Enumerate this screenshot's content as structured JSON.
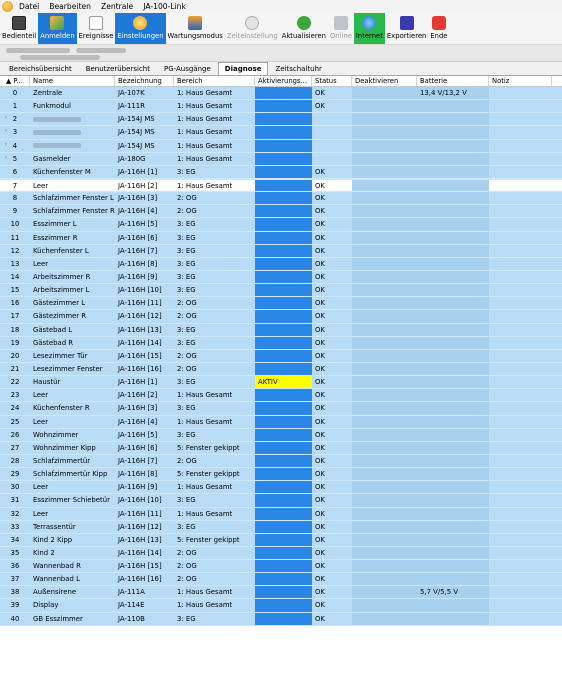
{
  "menu": {
    "items": [
      "Datei",
      "Bearbeiten",
      "Zentrale",
      "JA-100-Link"
    ]
  },
  "toolbar": {
    "buttons": [
      {
        "label": "Bedienteil",
        "icon": "keypad-icon"
      },
      {
        "label": "Anmelden",
        "icon": "login-icon"
      },
      {
        "label": "Ereignisse",
        "icon": "events-icon"
      },
      {
        "label": "Einstellungen",
        "icon": "settings-icon"
      },
      {
        "label": "Wartungsmodus",
        "icon": "maintenance-icon"
      },
      {
        "label": "Zeiteinstellung",
        "icon": "clock-icon"
      },
      {
        "label": "Aktualisieren",
        "icon": "refresh-icon"
      },
      {
        "label": "Online",
        "icon": "online-icon"
      },
      {
        "label": "Internet",
        "icon": "internet-icon"
      },
      {
        "label": "Exportieren",
        "icon": "export-icon"
      },
      {
        "label": "Ende",
        "icon": "power-icon"
      }
    ]
  },
  "tabs": [
    "Bereichsübersicht",
    "Benutzerübersicht",
    "PG-Ausgänge",
    "Diagnose",
    "Zeitschaltuhr"
  ],
  "active_tab": "Diagnose",
  "table": {
    "headers": [
      "P...",
      "Name",
      "Bezeichnung",
      "Bereich",
      "Aktivierungs...",
      "Status",
      "Deaktivieren",
      "Batterie",
      "Notiz"
    ],
    "rows": [
      {
        "p": "0",
        "name": "Zentrale",
        "bez": "JA-107K",
        "ber": "1: Haus Gesamt",
        "akt": "",
        "status": "OK",
        "batt": "13,4 V/13,2 V"
      },
      {
        "p": "1",
        "name": "Funkmodul",
        "bez": "JA-111R",
        "ber": "1: Haus Gesamt",
        "akt": "",
        "status": "OK",
        "batt": ""
      },
      {
        "p": "2",
        "name": "",
        "bez": "JA-154J MS",
        "ber": "1: Haus Gesamt",
        "akt": "",
        "status": "",
        "batt": ""
      },
      {
        "p": "3",
        "name": "",
        "bez": "JA-154J MS",
        "ber": "1: Haus Gesamt",
        "akt": "",
        "status": "",
        "batt": ""
      },
      {
        "p": "4",
        "name": "",
        "bez": "JA-154J MS",
        "ber": "1: Haus Gesamt",
        "akt": "",
        "status": "",
        "batt": ""
      },
      {
        "p": "5",
        "name": "Gasmelder",
        "bez": "JA-180G",
        "ber": "1: Haus Gesamt",
        "akt": "",
        "status": "",
        "batt": ""
      },
      {
        "p": "6",
        "name": "Küchenfenster M",
        "bez": "JA-116H [1]",
        "ber": "3: EG",
        "akt": "",
        "status": "OK",
        "batt": ""
      },
      {
        "p": "7",
        "name": "Leer",
        "bez": "JA-116H [2]",
        "ber": "1: Haus Gesamt",
        "akt": "",
        "status": "OK",
        "batt": ""
      },
      {
        "p": "8",
        "name": "Schlafzimmer Fenster L",
        "bez": "JA-116H [3]",
        "ber": "2: OG",
        "akt": "",
        "status": "OK",
        "batt": ""
      },
      {
        "p": "9",
        "name": "Schlafzimmer Fenster R",
        "bez": "JA-116H [4]",
        "ber": "2: OG",
        "akt": "",
        "status": "OK",
        "batt": ""
      },
      {
        "p": "10",
        "name": "Esszimmer L",
        "bez": "JA-116H [5]",
        "ber": "3: EG",
        "akt": "",
        "status": "OK",
        "batt": ""
      },
      {
        "p": "11",
        "name": "Esszimmer R",
        "bez": "JA-116H [6]",
        "ber": "3: EG",
        "akt": "",
        "status": "OK",
        "batt": ""
      },
      {
        "p": "12",
        "name": "Küchenfenster L",
        "bez": "JA-116H [7]",
        "ber": "3: EG",
        "akt": "",
        "status": "OK",
        "batt": ""
      },
      {
        "p": "13",
        "name": "Leer",
        "bez": "JA-116H [8]",
        "ber": "3: EG",
        "akt": "",
        "status": "OK",
        "batt": ""
      },
      {
        "p": "14",
        "name": "Arbeitszimmer R",
        "bez": "JA-116H [9]",
        "ber": "3: EG",
        "akt": "",
        "status": "OK",
        "batt": ""
      },
      {
        "p": "15",
        "name": "Arbeitszimmer L",
        "bez": "JA-116H [10]",
        "ber": "3: EG",
        "akt": "",
        "status": "OK",
        "batt": ""
      },
      {
        "p": "16",
        "name": "Gästezimmer L",
        "bez": "JA-116H [11]",
        "ber": "2: OG",
        "akt": "",
        "status": "OK",
        "batt": ""
      },
      {
        "p": "17",
        "name": "Gästezimmer R",
        "bez": "JA-116H [12]",
        "ber": "2: OG",
        "akt": "",
        "status": "OK",
        "batt": ""
      },
      {
        "p": "18",
        "name": "Gästebad L",
        "bez": "JA-116H [13]",
        "ber": "3: EG",
        "akt": "",
        "status": "OK",
        "batt": ""
      },
      {
        "p": "19",
        "name": "Gästebad R",
        "bez": "JA-116H [14]",
        "ber": "3: EG",
        "akt": "",
        "status": "OK",
        "batt": ""
      },
      {
        "p": "20",
        "name": "Lesezimmer Tür",
        "bez": "JA-116H [15]",
        "ber": "2: OG",
        "akt": "",
        "status": "OK",
        "batt": ""
      },
      {
        "p": "21",
        "name": "Lesezimmer Fenster",
        "bez": "JA-116H [16]",
        "ber": "2: OG",
        "akt": "",
        "status": "OK",
        "batt": ""
      },
      {
        "p": "22",
        "name": "Haustür",
        "bez": "JA-116H [1]",
        "ber": "3: EG",
        "akt": "AKTIV",
        "status": "OK",
        "batt": ""
      },
      {
        "p": "23",
        "name": "Leer",
        "bez": "JA-116H [2]",
        "ber": "1: Haus Gesamt",
        "akt": "",
        "status": "OK",
        "batt": ""
      },
      {
        "p": "24",
        "name": "Küchenfenster R",
        "bez": "JA-116H [3]",
        "ber": "3: EG",
        "akt": "",
        "status": "OK",
        "batt": ""
      },
      {
        "p": "25",
        "name": "Leer",
        "bez": "JA-116H [4]",
        "ber": "1: Haus Gesamt",
        "akt": "",
        "status": "OK",
        "batt": ""
      },
      {
        "p": "26",
        "name": "Wohnzimmer",
        "bez": "JA-116H [5]",
        "ber": "3: EG",
        "akt": "",
        "status": "OK",
        "batt": ""
      },
      {
        "p": "27",
        "name": "Wohnzimmer Kipp",
        "bez": "JA-116H [6]",
        "ber": "5: Fenster gekippt",
        "akt": "",
        "status": "OK",
        "batt": ""
      },
      {
        "p": "28",
        "name": "Schlafzimmertür",
        "bez": "JA-116H [7]",
        "ber": "2: OG",
        "akt": "",
        "status": "OK",
        "batt": ""
      },
      {
        "p": "29",
        "name": "Schlafzimmertür Kipp",
        "bez": "JA-116H [8]",
        "ber": "5: Fenster gekippt",
        "akt": "",
        "status": "OK",
        "batt": ""
      },
      {
        "p": "30",
        "name": "Leer",
        "bez": "JA-116H [9]",
        "ber": "1: Haus Gesamt",
        "akt": "",
        "status": "OK",
        "batt": ""
      },
      {
        "p": "31",
        "name": "Esszimmer Schiebetür",
        "bez": "JA-116H [10]",
        "ber": "3: EG",
        "akt": "",
        "status": "OK",
        "batt": ""
      },
      {
        "p": "32",
        "name": "Leer",
        "bez": "JA-116H [11]",
        "ber": "1: Haus Gesamt",
        "akt": "",
        "status": "OK",
        "batt": ""
      },
      {
        "p": "33",
        "name": "Terrassentür",
        "bez": "JA-116H [12]",
        "ber": "3: EG",
        "akt": "",
        "status": "OK",
        "batt": ""
      },
      {
        "p": "34",
        "name": "Kind 2 Kipp",
        "bez": "JA-116H [13]",
        "ber": "5: Fenster gekippt",
        "akt": "",
        "status": "OK",
        "batt": ""
      },
      {
        "p": "35",
        "name": "Kind 2",
        "bez": "JA-116H [14]",
        "ber": "2: OG",
        "akt": "",
        "status": "OK",
        "batt": ""
      },
      {
        "p": "36",
        "name": "Wannenbad R",
        "bez": "JA-116H [15]",
        "ber": "2: OG",
        "akt": "",
        "status": "OK",
        "batt": ""
      },
      {
        "p": "37",
        "name": "Wannenbad L",
        "bez": "JA-116H [16]",
        "ber": "2: OG",
        "akt": "",
        "status": "OK",
        "batt": ""
      },
      {
        "p": "38",
        "name": "Außensirene",
        "bez": "JA-111A",
        "ber": "1: Haus Gesamt",
        "akt": "",
        "status": "OK",
        "batt": "5,7 V/5,5 V"
      },
      {
        "p": "39",
        "name": "Display",
        "bez": "JA-114E",
        "ber": "1: Haus Gesamt",
        "akt": "",
        "status": "OK",
        "batt": ""
      },
      {
        "p": "40",
        "name": "GB Esszimmer",
        "bez": "JA-110B",
        "ber": "3: EG",
        "akt": "",
        "status": "OK",
        "batt": ""
      }
    ]
  },
  "selected_row": "7",
  "colors": {
    "row_bg": "#b8dcf6",
    "activation_cell": "#2b87e6",
    "active_highlight": "#ffff00",
    "toolbar_active": "#1e78d8",
    "internet_button": "#29b94a"
  }
}
